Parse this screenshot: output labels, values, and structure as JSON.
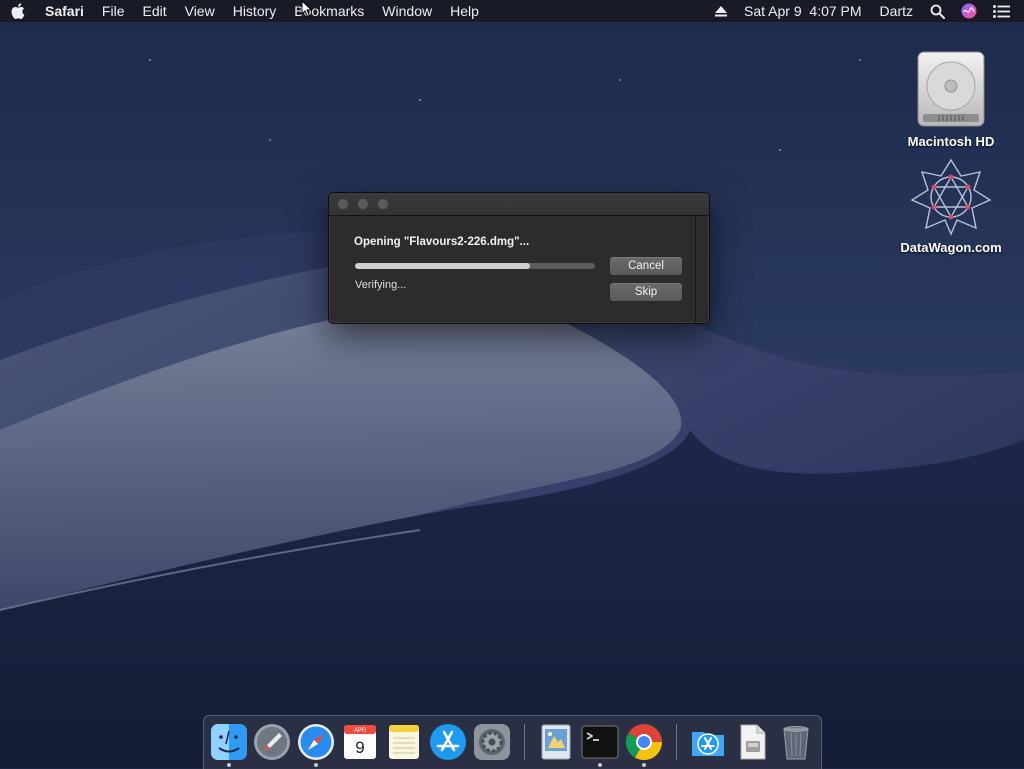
{
  "menubar": {
    "apple_icon": "apple-icon",
    "app_name": "Safari",
    "menus": [
      "File",
      "Edit",
      "View",
      "History",
      "Bookmarks",
      "Window",
      "Help"
    ],
    "status": {
      "eject_icon": "eject-icon",
      "datetime": "Sat Apr 9  4:07 PM",
      "user": "Dartz",
      "search_icon": "spotlight-search-icon",
      "siri_icon": "siri-icon",
      "notifications_icon": "notification-center-icon"
    }
  },
  "desktop": {
    "icons": [
      {
        "label": "Macintosh HD",
        "icon": "hard-drive-icon"
      },
      {
        "label": "DataWagon.com",
        "icon": "datawagon-logo-icon"
      }
    ]
  },
  "dialog": {
    "title": "Opening \"Flavours2-226.dmg\"...",
    "status": "Verifying...",
    "progress": 0.73,
    "cancel_label": "Cancel",
    "skip_label": "Skip"
  },
  "dock": {
    "items": [
      {
        "name": "Finder",
        "icon": "finder-icon",
        "running": true
      },
      {
        "name": "Launchpad",
        "icon": "launchpad-icon",
        "running": false
      },
      {
        "name": "Safari",
        "icon": "safari-icon",
        "running": true
      },
      {
        "name": "Calendar",
        "icon": "calendar-icon",
        "running": false,
        "month": "APR",
        "day": "9"
      },
      {
        "name": "Notes",
        "icon": "notes-icon",
        "running": false
      },
      {
        "name": "App Store",
        "icon": "app-store-icon",
        "running": false
      },
      {
        "name": "System Preferences",
        "icon": "system-preferences-icon",
        "running": false
      },
      {
        "name": "Preview",
        "icon": "preview-icon",
        "running": false
      },
      {
        "name": "Terminal",
        "icon": "terminal-icon",
        "running": true
      },
      {
        "name": "Chrome",
        "icon": "chrome-icon",
        "running": true
      },
      {
        "name": "Downloads",
        "icon": "downloads-folder-icon",
        "running": false
      },
      {
        "name": "Document",
        "icon": "document-icon",
        "running": false
      },
      {
        "name": "Trash",
        "icon": "trash-icon",
        "running": false
      }
    ]
  },
  "colors": {
    "accent_blue": "#1e9bf0",
    "dialog_bg": "#2c2c2e",
    "menubar_bg": "#181a22"
  }
}
